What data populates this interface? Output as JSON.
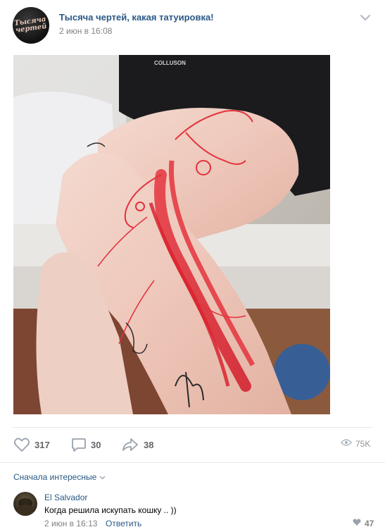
{
  "post": {
    "group_name": "Тысяча чертей, какая татуировка!",
    "avatar_text_line1": "Тысяча",
    "avatar_text_line2": "чертей",
    "date": "2 июн в 16:08",
    "photo_shirt_text": "COLLUSON"
  },
  "actions": {
    "likes": "317",
    "comments": "30",
    "shares": "38",
    "views": "75K"
  },
  "comments": {
    "sort_label": "Сначала интересные",
    "items": [
      {
        "author": "El Salvador",
        "text": "Когда решила искупать кошку .. ))",
        "date": "2 июн в 16:13",
        "reply_label": "Ответить",
        "likes": "47"
      }
    ]
  },
  "colors": {
    "link": "#2a5885",
    "muted": "#828282",
    "divider": "#e7e8ec"
  }
}
